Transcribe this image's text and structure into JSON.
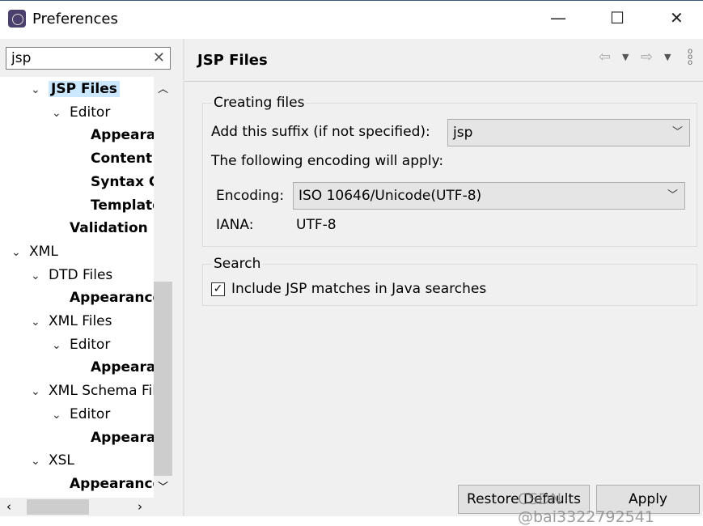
{
  "window": {
    "title": "Preferences",
    "minimize": "—",
    "maximize": "☐",
    "close": "✕"
  },
  "search": {
    "value": "jsp",
    "clear": "✕"
  },
  "tree": [
    {
      "label": "JSP Files",
      "level": 1,
      "expanded": true,
      "bold": true,
      "selected": true
    },
    {
      "label": "Editor",
      "level": 2,
      "expanded": true
    },
    {
      "label": "Appearance",
      "level": 3,
      "bold": true
    },
    {
      "label": "Content Assist",
      "level": 3,
      "bold": true
    },
    {
      "label": "Syntax Coloring",
      "level": 3,
      "bold": true
    },
    {
      "label": "Templates",
      "level": 3,
      "bold": true
    },
    {
      "label": "Validation",
      "level": 2,
      "bold": true
    },
    {
      "label": "XML",
      "level": 0,
      "expanded": true
    },
    {
      "label": "DTD Files",
      "level": 1,
      "expanded": true
    },
    {
      "label": "Appearance",
      "level": 2,
      "bold": true
    },
    {
      "label": "XML Files",
      "level": 1,
      "expanded": true
    },
    {
      "label": "Editor",
      "level": 2,
      "expanded": true
    },
    {
      "label": "Appearance",
      "level": 3,
      "bold": true
    },
    {
      "label": "XML Schema Files",
      "level": 1,
      "expanded": true
    },
    {
      "label": "Editor",
      "level": 2,
      "expanded": true
    },
    {
      "label": "Appearance",
      "level": 3,
      "bold": true
    },
    {
      "label": "XSL",
      "level": 1,
      "expanded": true
    },
    {
      "label": "Appearance",
      "level": 2,
      "bold": true
    }
  ],
  "page": {
    "title": "JSP Files",
    "creating": {
      "group_label": "Creating files",
      "suffix_label": "Add this suffix (if not specified):",
      "suffix_value": "jsp",
      "encoding_note": "The following encoding will apply:",
      "encoding_label": "Encoding:",
      "encoding_value": "ISO 10646/Unicode(UTF-8)",
      "iana_label": "IANA:",
      "iana_value": "UTF-8"
    },
    "search": {
      "group_label": "Search",
      "include_label": "Include JSP matches in Java searches",
      "include_checked": true
    },
    "restore_label": "Restore Defaults",
    "apply_label": "Apply"
  },
  "watermark": "CSDN @bai3322792541"
}
